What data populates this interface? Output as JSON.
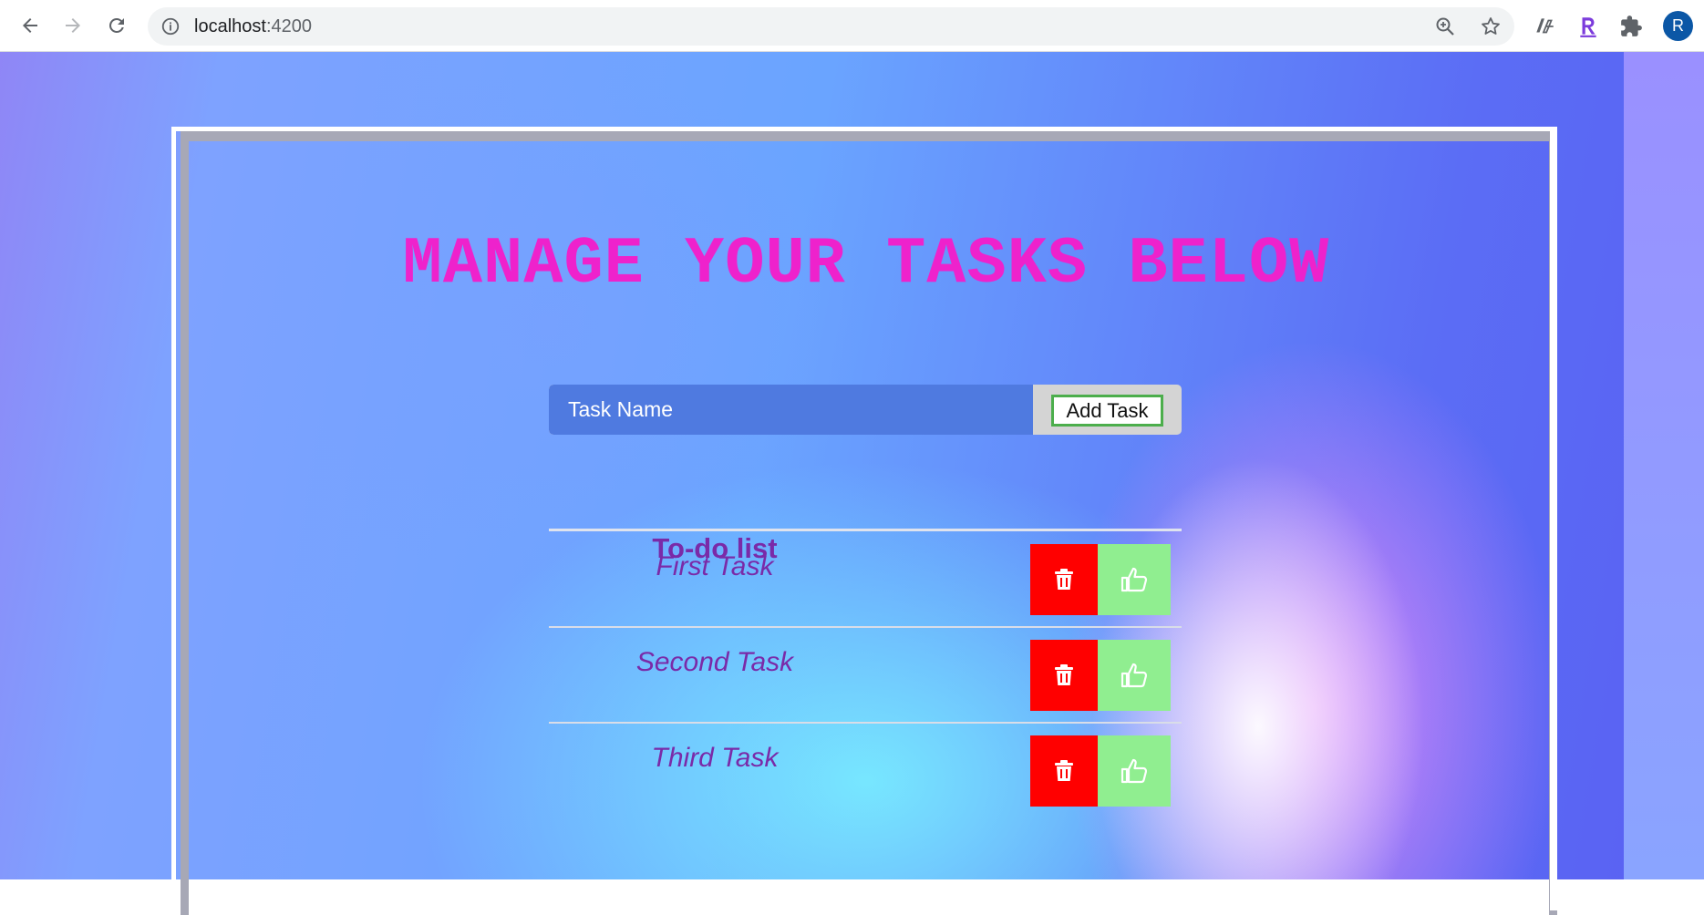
{
  "browser": {
    "url_host": "localhost",
    "url_port": ":4200",
    "profile_initial": "R",
    "icons": [
      "back-arrow-icon",
      "forward-arrow-icon",
      "reload-icon",
      "info-icon",
      "zoom-icon",
      "star-icon",
      "extension-icon",
      "extension-r-icon",
      "puzzle-icon"
    ]
  },
  "page": {
    "title": "MANAGE YOUR TASKS BELOW",
    "add_task": {
      "placeholder": "Task Name",
      "button_label": "Add Task"
    },
    "list": {
      "header": "To-do list",
      "tasks": [
        {
          "name": "First Task"
        },
        {
          "name": "Second Task"
        },
        {
          "name": "Third Task"
        }
      ]
    }
  },
  "colors": {
    "title": "#ee22cc",
    "input_bg": "#4f7ae0",
    "delete_bg": "#ff0000",
    "done_bg": "#90ee90",
    "task_text": "#7a2aa8"
  }
}
